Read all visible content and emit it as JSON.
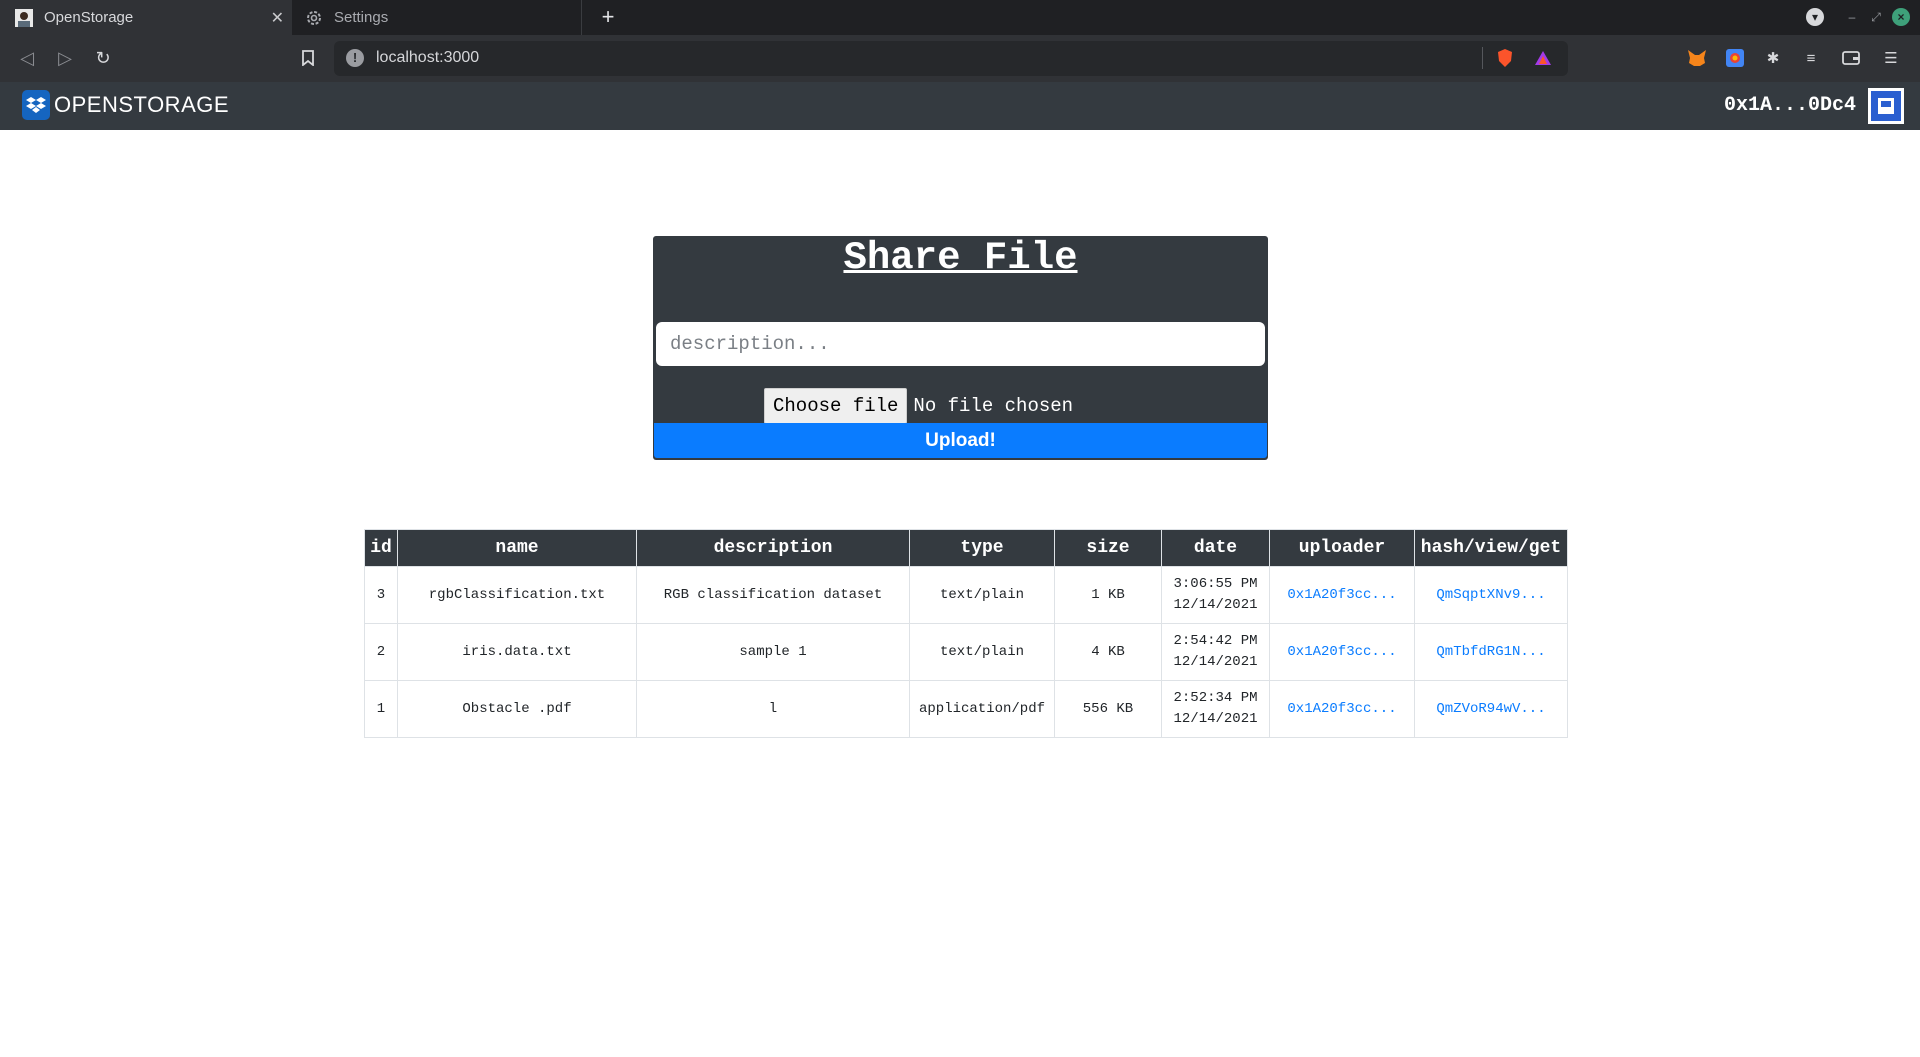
{
  "browser": {
    "tabs": [
      {
        "title": "OpenStorage",
        "icon": "user-photo-icon",
        "active": true
      },
      {
        "title": "Settings",
        "icon": "gear-icon",
        "active": false
      }
    ],
    "url": "localhost:3000"
  },
  "app": {
    "brand": "OPENSTORAGE",
    "account": "0x1A...0Dc4"
  },
  "share": {
    "title": "Share File",
    "description_placeholder": "description...",
    "choose_file_label": "Choose file",
    "no_file_label": "No file chosen",
    "upload_label": "Upload!"
  },
  "table": {
    "headers": [
      "id",
      "name",
      "description",
      "type",
      "size",
      "date",
      "uploader",
      "hash/view/get"
    ],
    "rows": [
      {
        "id": "3",
        "name": "rgbClassification.txt",
        "description": "RGB classification dataset",
        "type": "text/plain",
        "size": "1 KB",
        "time": "3:06:55 PM",
        "date": "12/14/2021",
        "uploader": "0x1A20f3cc...",
        "hash": "QmSqptXNv9..."
      },
      {
        "id": "2",
        "name": "iris.data.txt",
        "description": "sample 1",
        "type": "text/plain",
        "size": "4 KB",
        "time": "2:54:42 PM",
        "date": "12/14/2021",
        "uploader": "0x1A20f3cc...",
        "hash": "QmTbfdRG1N..."
      },
      {
        "id": "1",
        "name": "Obstacle .pdf",
        "description": "l",
        "type": "application/pdf",
        "size": "556 KB",
        "time": "2:52:34 PM",
        "date": "12/14/2021",
        "uploader": "0x1A20f3cc...",
        "hash": "QmZVoR94wV..."
      }
    ]
  },
  "colors": {
    "appbar": "#343a40",
    "accent": "#0a7cff"
  }
}
